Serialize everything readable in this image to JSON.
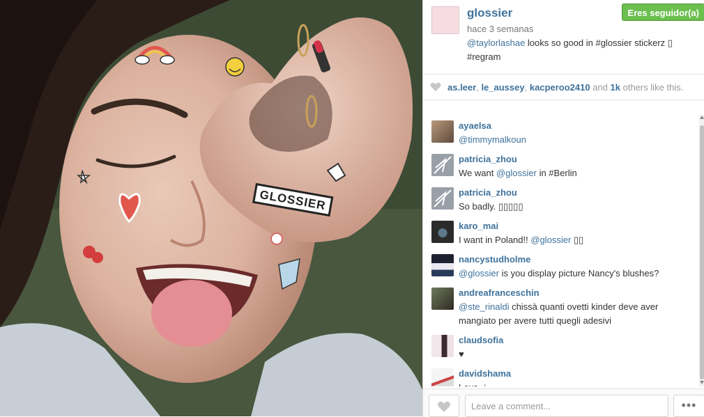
{
  "post": {
    "username": "glossier",
    "follow_label": "Eres seguidor(a)",
    "time": "hace 3 semanas",
    "caption_mention": "@taylorlashae",
    "caption_text": " looks so good in #glossier stickerz ▯",
    "caption_tag": "#regram",
    "photo_sticker_text": "GLOSSIER"
  },
  "likes": {
    "user1": "as.leer",
    "user2": "le_aussey",
    "user3": "kacperoo2410",
    "and_word": "and",
    "count": "1k",
    "rest": "others like this."
  },
  "comments": [
    {
      "user": "ayaelsa",
      "mention": "@timmymalkoun",
      "text": "",
      "mention2": "",
      "text2": ""
    },
    {
      "user": "patricia_zhou",
      "text": "We want ",
      "mention": "@glossier",
      "text2": " in #Berlin"
    },
    {
      "user": "patricia_zhou",
      "text": "So badly. ▯▯▯▯▯"
    },
    {
      "user": "karo_mai",
      "text": "I want in Poland!! ",
      "mention": "@glossier",
      "text2": " ▯▯"
    },
    {
      "user": "nancystudholme",
      "mention": "@glossier",
      "text2": " is you display picture Nancy's blushes?"
    },
    {
      "user": "andreafranceschin",
      "mention": "@ste_rinaldi",
      "text2": " chissà quanti ovetti kinder deve aver mangiato per avere tutti quegli adesivi"
    },
    {
      "user": "claudsofia",
      "text": "♥"
    },
    {
      "user": "davidshama",
      "text": "Love ☆"
    }
  ],
  "footer": {
    "comment_placeholder": "Leave a comment...",
    "more_label": "•••"
  },
  "colors": {
    "link": "#3f729b",
    "follow_green": "#6bbf4e"
  }
}
